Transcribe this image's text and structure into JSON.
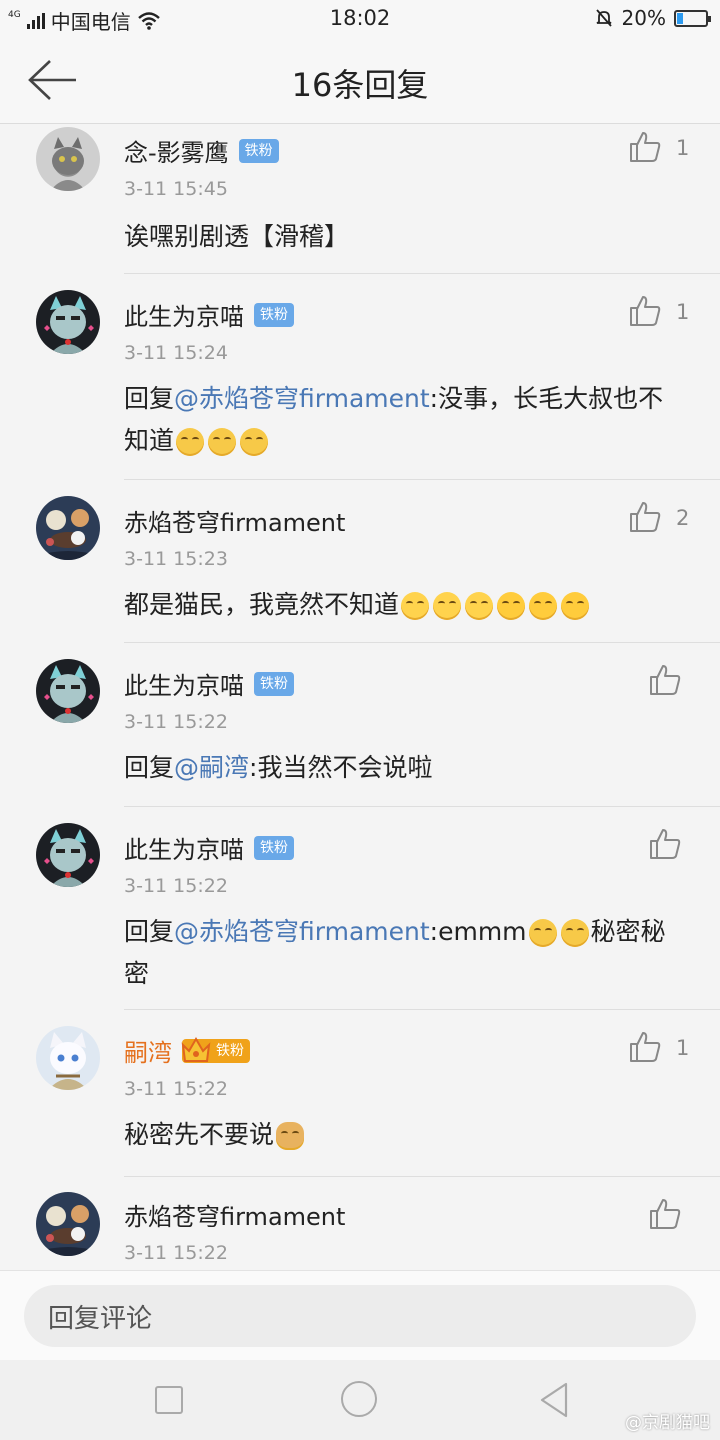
{
  "status_bar": {
    "network": "4G",
    "carrier": "中国电信",
    "time": "18:02",
    "battery": "20%",
    "battery_level": 0.2
  },
  "header": {
    "title": "16条回复",
    "back_icon": "arrow-left-icon"
  },
  "badge_label": "铁粉",
  "comments": [
    {
      "user": "念-影雾鹰",
      "time": "3-11 15:45",
      "text": "诶嘿别剧透【滑稽】",
      "likes": "1"
    },
    {
      "user": "此生为京喵",
      "time": "3-11 15:24",
      "reply_prefix": "回复",
      "mention": "@赤焰苍穹firmament",
      "text": ":没事，长毛大叔也不知道",
      "emoji": [
        "smile-emoji",
        "smile-emoji",
        "smile-emoji"
      ],
      "likes": "1"
    },
    {
      "user": "赤焰苍穹firmament",
      "time": "3-11 15:23",
      "text": "都是猫民，我竟然不知道",
      "emoji": [
        "laugh-cry-emoji",
        "laugh-cry-emoji",
        "laugh-cry-emoji",
        "crying-emoji",
        "crying-emoji",
        "crying-emoji"
      ],
      "likes": "2"
    },
    {
      "user": "此生为京喵",
      "time": "3-11 15:22",
      "reply_prefix": "回复",
      "mention": "@嗣湾",
      "text": ":我当然不会说啦",
      "likes": ""
    },
    {
      "user": "此生为京喵",
      "time": "3-11 15:22",
      "reply_prefix": "回复",
      "mention": "@赤焰苍穹firmament",
      "text": ":emmm",
      "emoji": [
        "smile-emoji",
        "smile-emoji"
      ],
      "text_after": "秘密秘密",
      "likes": ""
    },
    {
      "user": "嗣湾",
      "time": "3-11 15:22",
      "text": "秘密先不要说",
      "emoji": [
        "doge-emoji"
      ],
      "likes": "1"
    },
    {
      "user": "赤焰苍穹firmament",
      "time": "3-11 15:22",
      "likes": ""
    }
  ],
  "reply_bar": {
    "placeholder": "回复评论"
  },
  "nav_bar": {
    "items": [
      "recent-apps-icon",
      "home-icon",
      "back-icon"
    ]
  },
  "watermark": "@京剧猫吧",
  "colors": {
    "mention": "#4a78b5",
    "badge": "#69a8e8",
    "gold_badge": "#f0a21a",
    "gold_name": "#e5711e"
  }
}
